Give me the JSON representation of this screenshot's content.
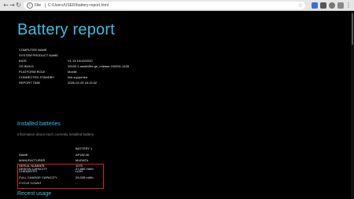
{
  "browser": {
    "file_label": "File",
    "address": "C:/Users/USER/battery-report.html"
  },
  "report": {
    "title": "Battery report",
    "system_info": [
      {
        "key": "COMPUTER NAME",
        "value": ""
      },
      {
        "key": "SYSTEM PRODUCT NAME",
        "value": ""
      },
      {
        "key": "BIOS",
        "value": "V1.13 10/15/2020"
      },
      {
        "key": "OS BUILD",
        "value": "26100.1.amd64fre.ge_release.240331-1435"
      },
      {
        "key": "PLATFORM ROLE",
        "value": "Mobile"
      },
      {
        "key": "CONNECTED STANDBY",
        "value": "Not supported"
      },
      {
        "key": "REPORT TIME",
        "value": "2026-02-25  16:15:32"
      }
    ],
    "installed_batteries": {
      "heading": "Installed batteries",
      "subheading": "Information about each currently installed battery",
      "column_header": "BATTERY 1",
      "rows": [
        {
          "key": "NAME",
          "value": "AP18C4K"
        },
        {
          "key": "MANUFACTURER",
          "value": "MURATA"
        },
        {
          "key": "SERIAL NUMBER",
          "value": "1075"
        },
        {
          "key": "CHEMISTRY",
          "value": "LiON"
        },
        {
          "key": "DESIGN CAPACITY",
          "value": "47,880 mWh"
        },
        {
          "key": "FULL CHARGE CAPACITY",
          "value": "29,935 mWh"
        },
        {
          "key": "CYCLE COUNT",
          "value": "-"
        }
      ]
    },
    "recent_usage": {
      "heading": "Recent usage"
    }
  },
  "colors": {
    "accent": "#38c0e0",
    "highlight_box": "#d81e1e",
    "background": "#000000"
  }
}
